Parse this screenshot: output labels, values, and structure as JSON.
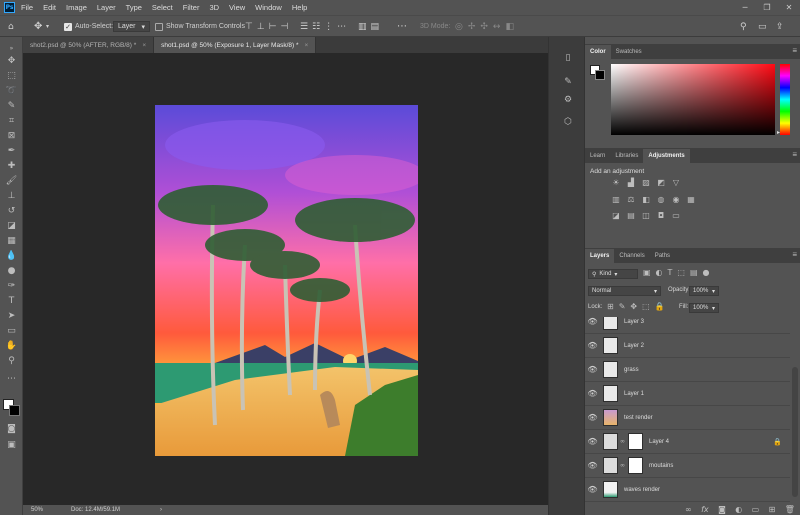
{
  "menubar": {
    "app_logo": "Ps",
    "items": [
      "File",
      "Edit",
      "Image",
      "Layer",
      "Type",
      "Select",
      "Filter",
      "3D",
      "View",
      "Window",
      "Help"
    ]
  },
  "window_controls": [
    "minimize-icon",
    "restore-icon",
    "close-icon"
  ],
  "options_bar": {
    "auto_select_label": "Auto-Select:",
    "auto_select_value": "Layer",
    "show_transform_label": "Show Transform Controls",
    "mode_3d": "3D Mode:"
  },
  "tabs": [
    {
      "label": "shot2.psd @ 50% (AFTER, RGB/8) *",
      "active": false
    },
    {
      "label": "shot1.psd @ 50% (Exposure 1, Layer Mask/8) *",
      "active": true
    }
  ],
  "status": {
    "zoom": "50%",
    "doc": "Doc: 12.4M/59.1M"
  },
  "color_panel": {
    "tabs": [
      "Color",
      "Swatches"
    ],
    "accent": "#e01020"
  },
  "adjust_panel": {
    "tabs": [
      "Learn",
      "Libraries",
      "Adjustments"
    ],
    "title": "Add an adjustment"
  },
  "layers_panel": {
    "tabs": [
      "Layers",
      "Channels",
      "Paths"
    ],
    "kind": "Kind",
    "blend_mode": "Normal",
    "opacity_label": "Opacity:",
    "opacity_value": "100%",
    "lock_label": "Lock:",
    "fill_label": "Fill:",
    "fill_value": "100%",
    "layers": [
      {
        "name": "Layer 3",
        "kind": "plain"
      },
      {
        "name": "Layer 2",
        "kind": "plain"
      },
      {
        "name": "grass",
        "kind": "plain"
      },
      {
        "name": "Layer 1",
        "kind": "plain"
      },
      {
        "name": "test render",
        "kind": "image"
      },
      {
        "name": "Layer 4",
        "kind": "mask",
        "locked": true
      },
      {
        "name": "moutains",
        "kind": "mask"
      },
      {
        "name": "waves render",
        "kind": "image"
      }
    ]
  }
}
